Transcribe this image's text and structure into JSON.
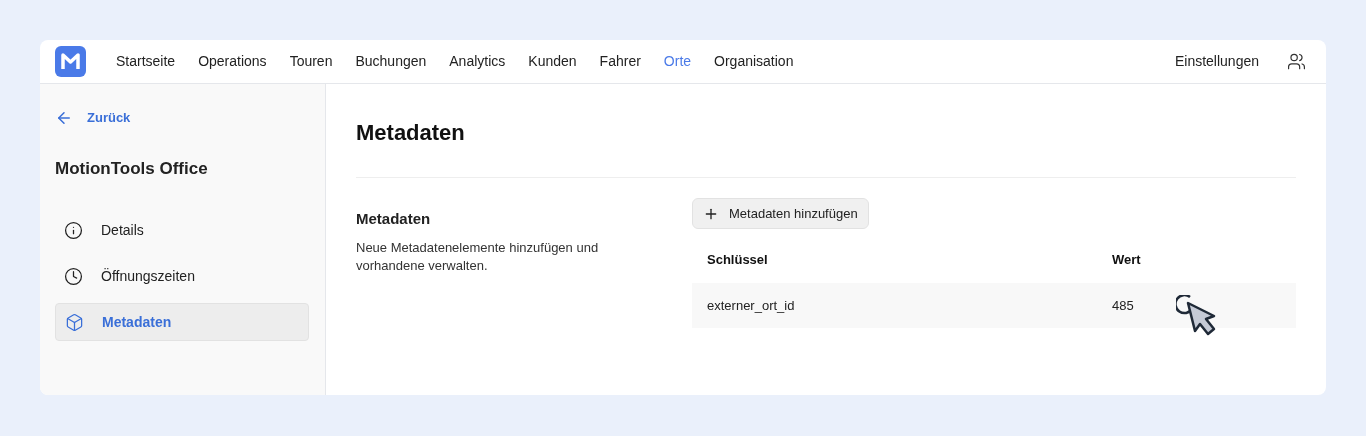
{
  "nav": {
    "items": [
      {
        "label": "Startseite",
        "selected": false
      },
      {
        "label": "Operations",
        "selected": false
      },
      {
        "label": "Touren",
        "selected": false
      },
      {
        "label": "Buchungen",
        "selected": false
      },
      {
        "label": "Analytics",
        "selected": false
      },
      {
        "label": "Kunden",
        "selected": false
      },
      {
        "label": "Fahrer",
        "selected": false
      },
      {
        "label": "Orte",
        "selected": true
      },
      {
        "label": "Organisation",
        "selected": false
      }
    ],
    "settings": "Einstellungen"
  },
  "sidebar": {
    "back": "Zurück",
    "title": "MotionTools Office",
    "items": [
      {
        "label": "Details",
        "kind": "info",
        "selected": false
      },
      {
        "label": "Öffnungszeiten",
        "kind": "clock",
        "selected": false
      },
      {
        "label": "Metadaten",
        "kind": "box",
        "selected": true
      }
    ]
  },
  "main": {
    "title": "Metadaten",
    "section_title": "Metadaten",
    "section_text": "Neue Metadatenelemente hinzufügen und vorhandene verwalten.",
    "add_button": "Metadaten hinzufügen",
    "table": {
      "columns": [
        "Schlüssel",
        "Wert"
      ],
      "rows": [
        [
          "externer_ort_id",
          "485"
        ]
      ]
    }
  }
}
